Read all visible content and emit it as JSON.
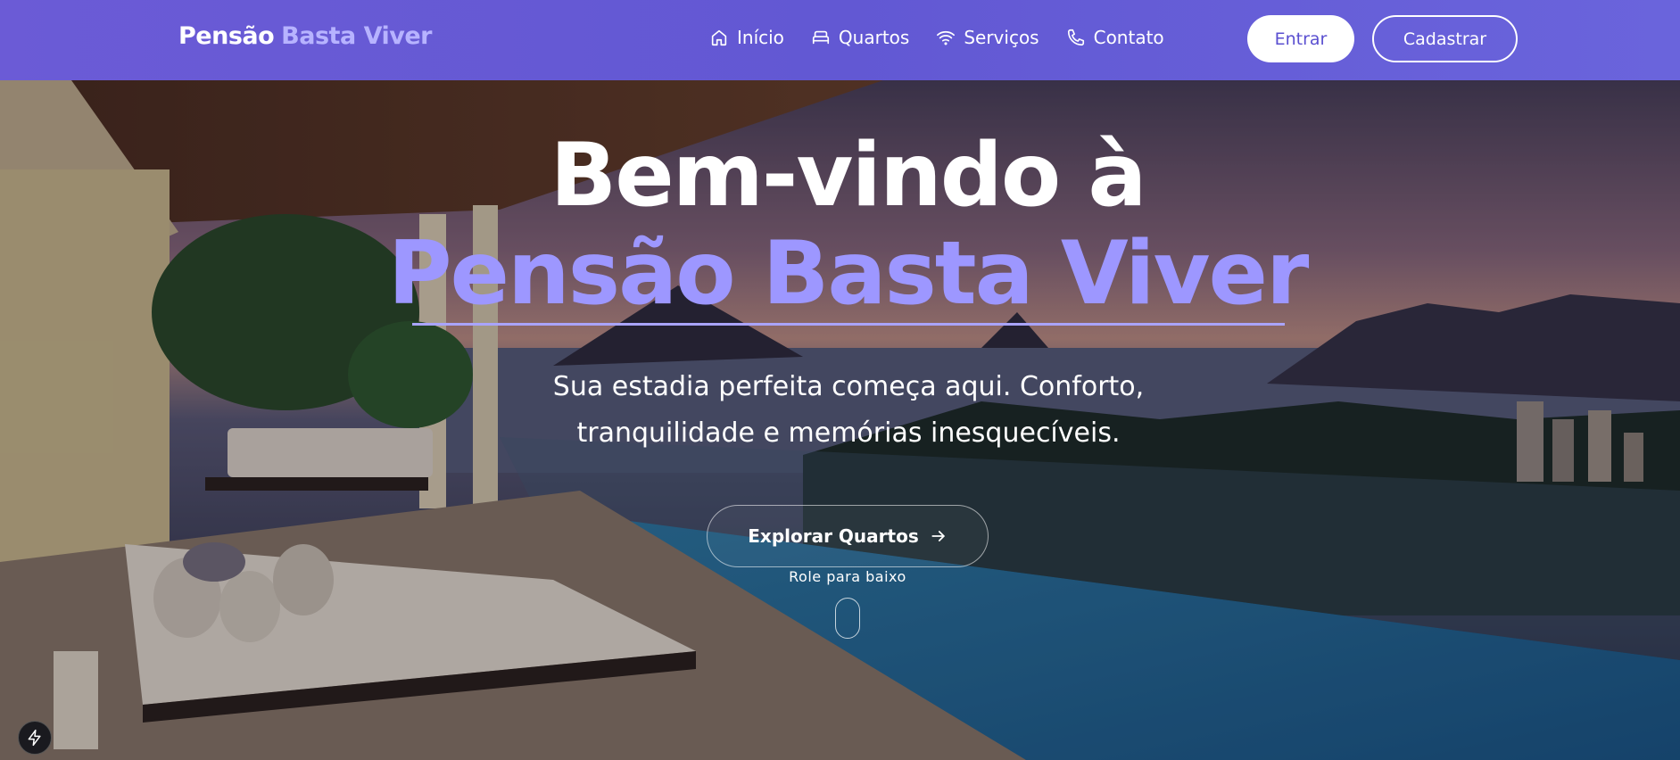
{
  "brand": {
    "part1": "Pensão",
    "part2": "Basta Viver"
  },
  "nav": {
    "items": [
      {
        "label": "Início",
        "icon": "home-icon"
      },
      {
        "label": "Quartos",
        "icon": "bed-icon"
      },
      {
        "label": "Serviços",
        "icon": "wifi-icon"
      },
      {
        "label": "Contato",
        "icon": "phone-icon"
      }
    ]
  },
  "auth": {
    "login_label": "Entrar",
    "signup_label": "Cadastrar"
  },
  "hero": {
    "title_line1": "Bem-vindo à",
    "title_line2": "Pensão Basta Viver",
    "subtitle": "Sua estadia perfeita começa aqui. Conforto, tranquilidade e memórias inesquecíveis.",
    "cta_label": "Explorar Quartos",
    "scroll_hint": "Role para baixo"
  },
  "colors": {
    "header_bg": "#6258d3",
    "accent": "#9d97ff",
    "button_text": "#5a4fd0"
  }
}
